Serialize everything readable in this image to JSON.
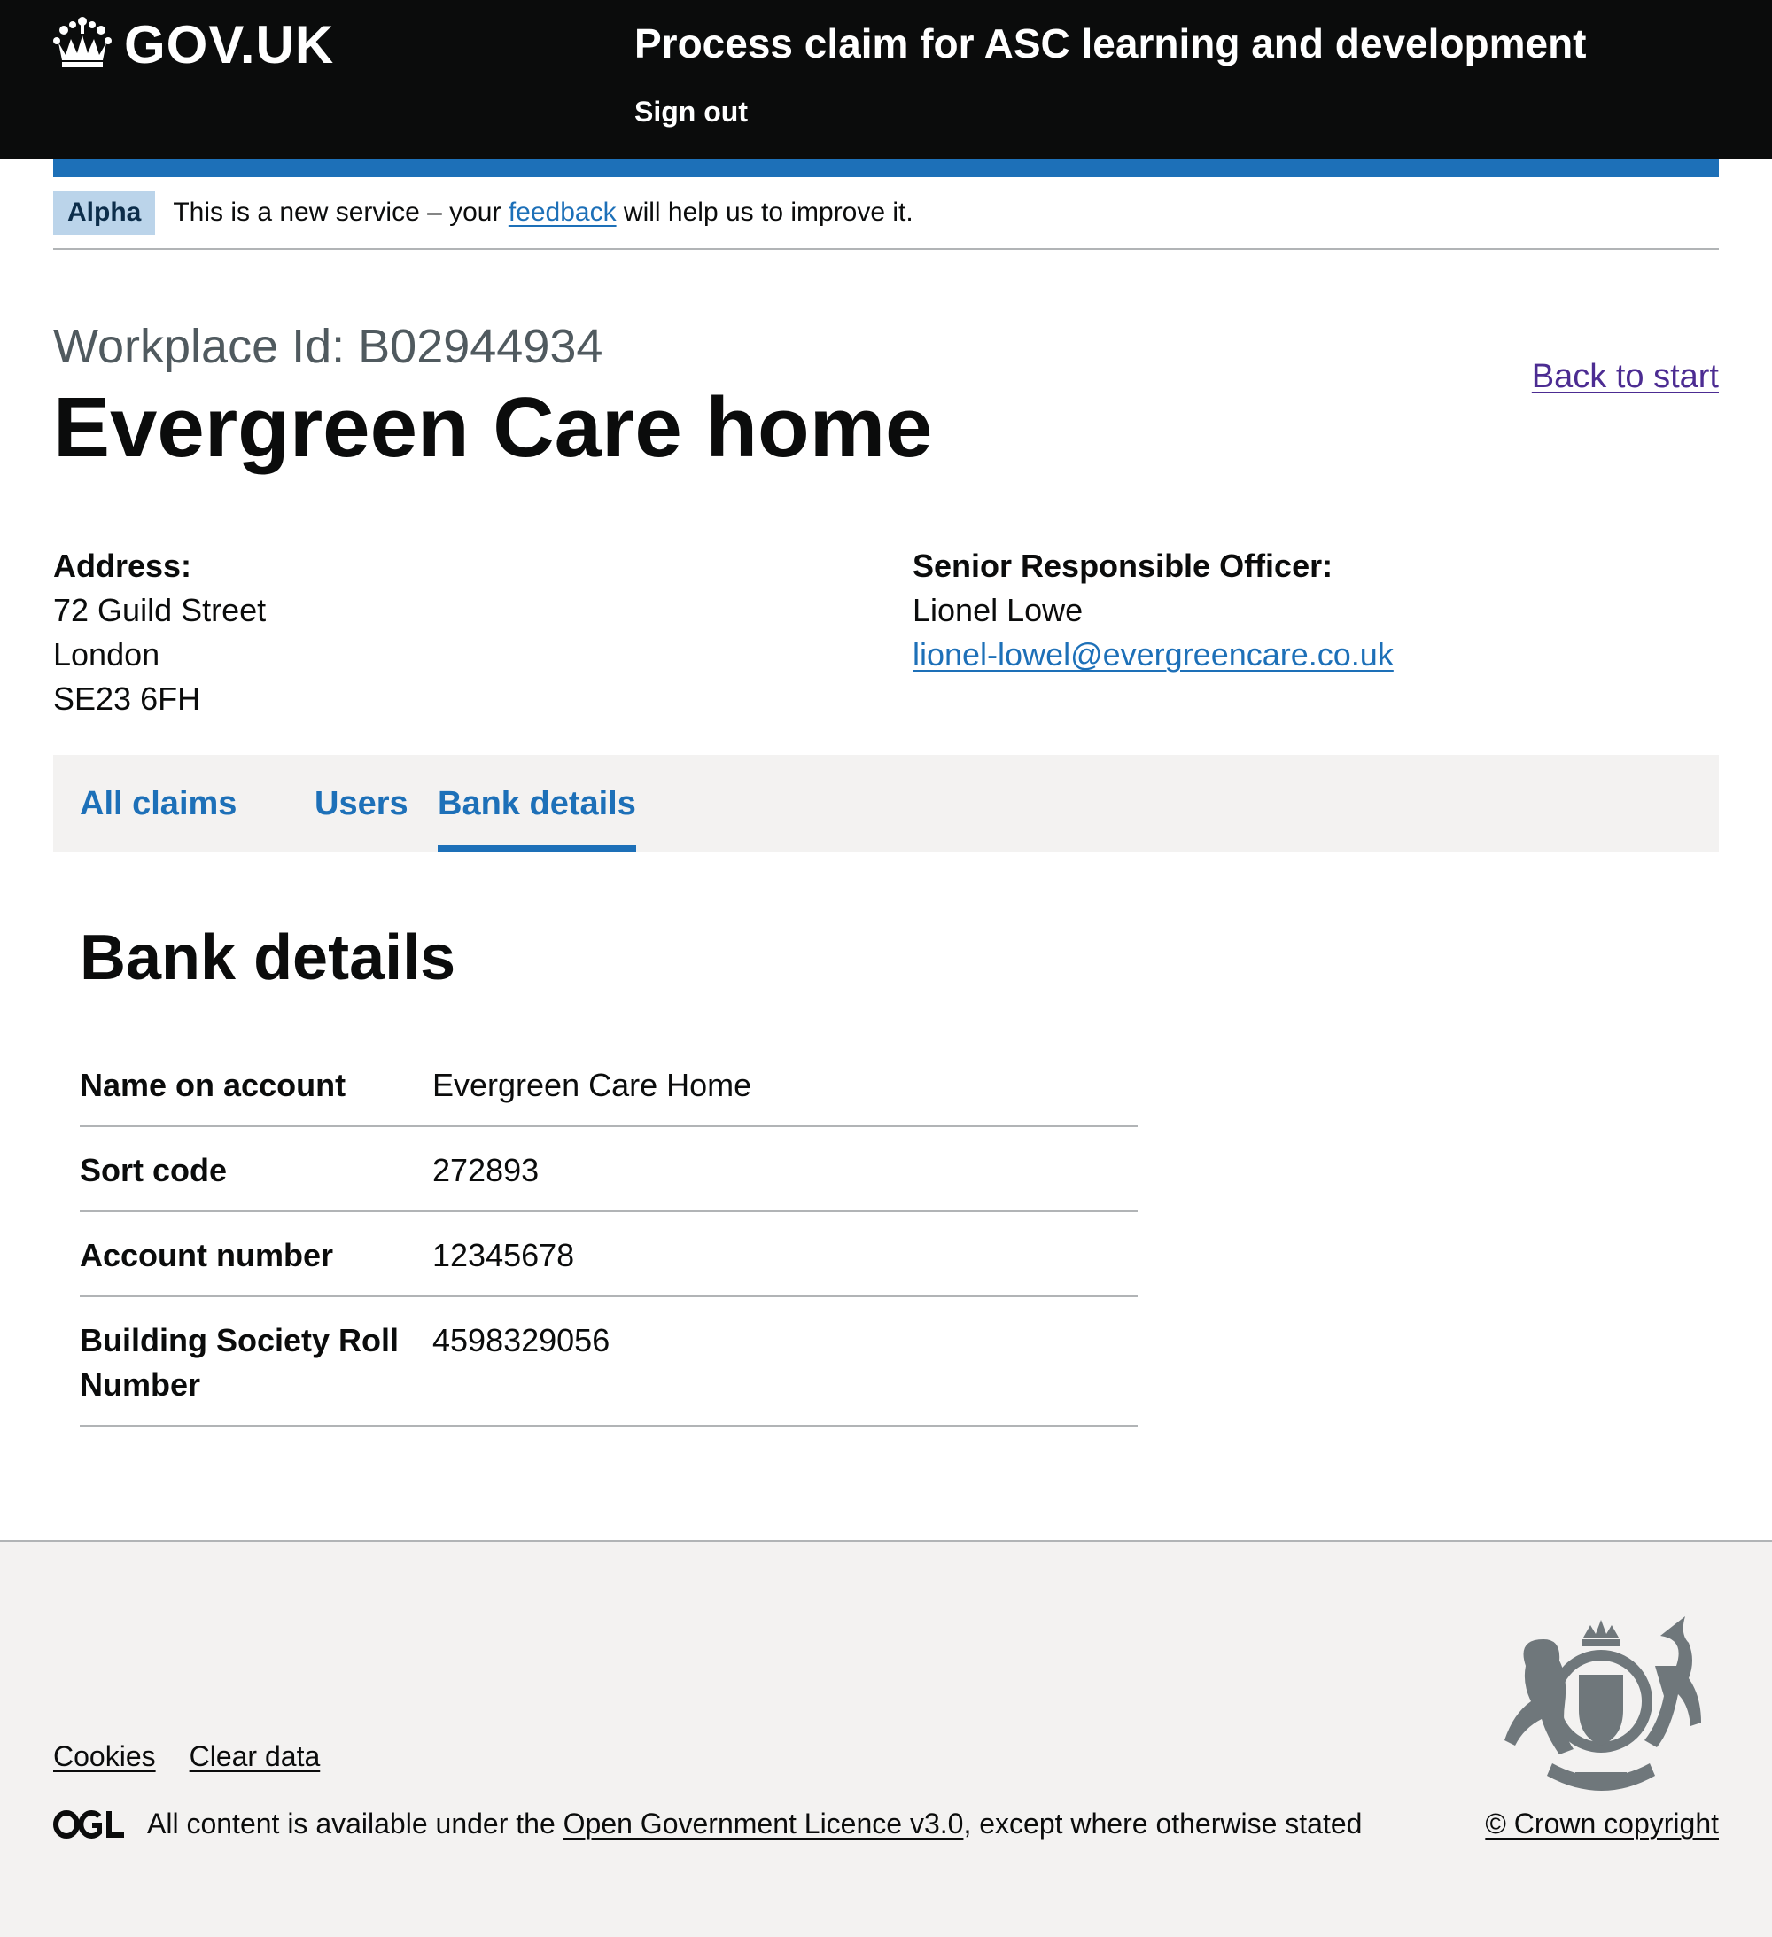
{
  "header": {
    "logo_text": "GOV.UK",
    "service_name": "Process claim for ASC learning and development",
    "sign_out": "Sign out"
  },
  "phase_banner": {
    "tag": "Alpha",
    "text_before": "This is a new service – your ",
    "link": "feedback",
    "text_after": " will help us to improve it."
  },
  "page": {
    "caption": "Workplace Id: B02944934",
    "title": "Evergreen Care home",
    "back_link": "Back to start"
  },
  "address": {
    "label": "Address:",
    "lines": [
      "72 Guild Street",
      "London",
      "SE23 6FH"
    ]
  },
  "sro": {
    "label": "Senior Responsible Officer:",
    "name": "Lionel Lowe",
    "email": "lionel-lowel@evergreencare.co.uk"
  },
  "tabs": [
    {
      "label": "All claims",
      "active": false
    },
    {
      "label": "Users",
      "active": false
    },
    {
      "label": "Bank details",
      "active": true
    }
  ],
  "bank_details": {
    "title": "Bank details",
    "rows": [
      {
        "key": "Name on account",
        "value": "Evergreen Care Home"
      },
      {
        "key": "Sort code",
        "value": "272893"
      },
      {
        "key": "Account number",
        "value": "12345678"
      },
      {
        "key": "Building Society Roll Number",
        "value": "4598329056"
      }
    ]
  },
  "footer": {
    "links": [
      "Cookies",
      "Clear data"
    ],
    "licence_before": "All content is available under the ",
    "licence_link": "Open Government Licence v3.0",
    "licence_after": ", except where otherwise stated",
    "copyright": "© Crown copyright"
  },
  "colors": {
    "header_bg": "#0b0c0c",
    "brand_blue": "#1d70b8",
    "visited_link": "#4c2c92",
    "footer_bg": "#f3f2f1",
    "phase_tag_bg": "#bbd4ea"
  }
}
